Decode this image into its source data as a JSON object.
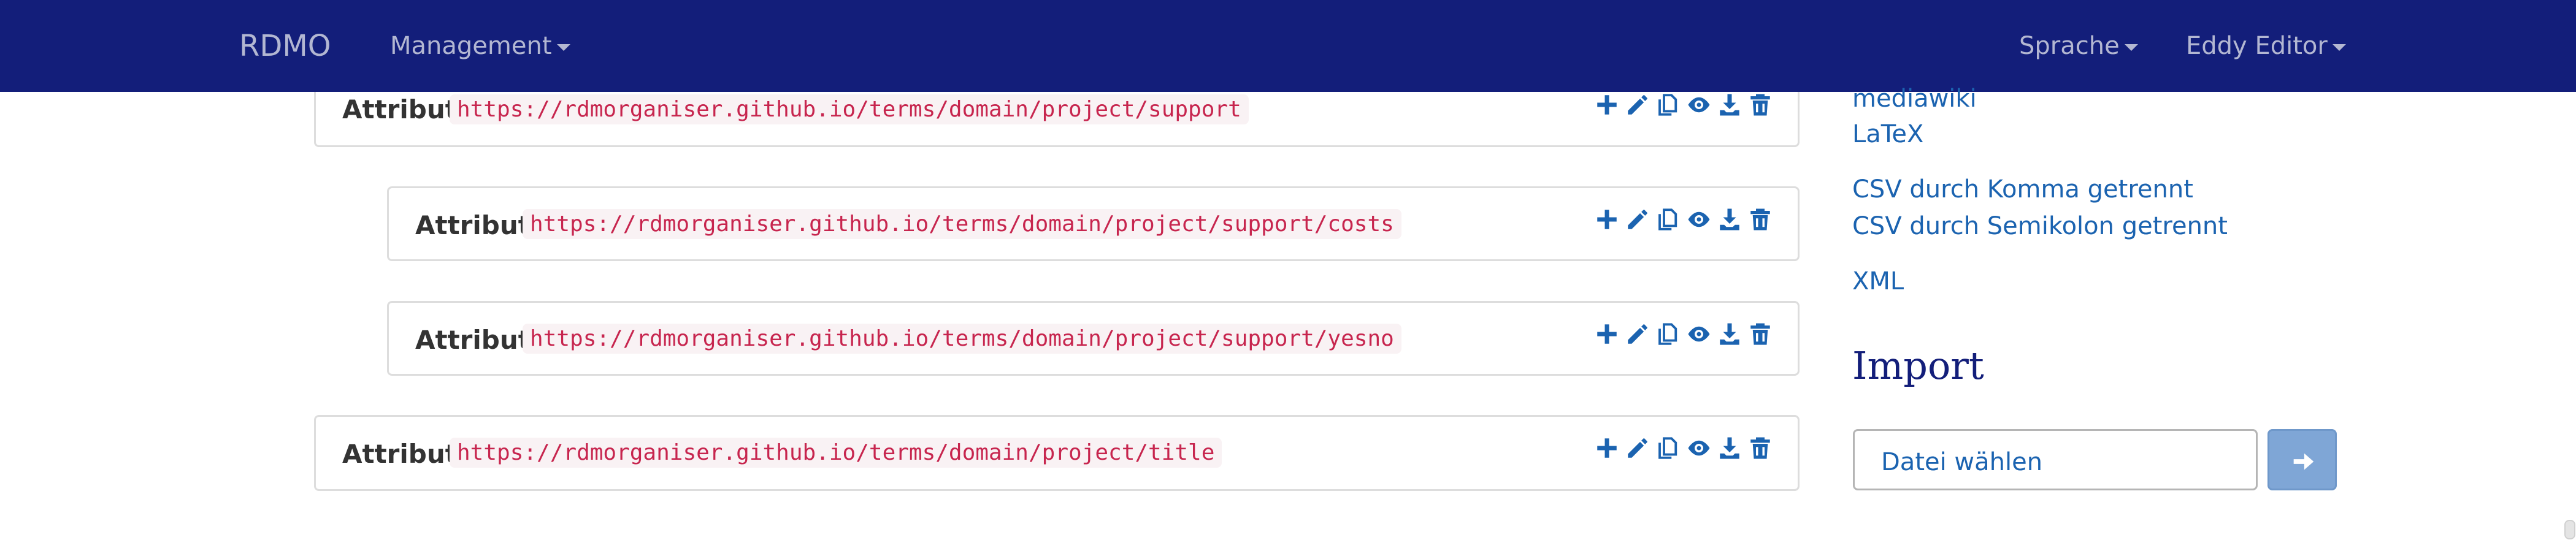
{
  "navbar": {
    "brand": "RDMO",
    "management_label": "Management",
    "language_label": "Sprache",
    "user_label": "Eddy Editor"
  },
  "elements": [
    {
      "label": "Attribut",
      "uri": "https://rdmorganiser.github.io/terms/domain/project/support"
    },
    {
      "label": "Attribut",
      "uri": "https://rdmorganiser.github.io/terms/domain/project/support/costs"
    },
    {
      "label": "Attribut",
      "uri": "https://rdmorganiser.github.io/terms/domain/project/support/yesno"
    },
    {
      "label": "Attribut",
      "uri": "https://rdmorganiser.github.io/terms/domain/project/title"
    }
  ],
  "actions": [
    "plus-icon",
    "pencil-icon",
    "copy-icon",
    "eye-icon",
    "download-icon",
    "trash-icon"
  ],
  "sidebar": {
    "export_links": [
      "mediawiki",
      "LaTeX",
      "CSV durch Komma getrennt",
      "CSV durch Semikolon getrennt",
      "XML"
    ],
    "import_heading": "Import",
    "file_input_placeholder": "Datei wählen",
    "upload_icon": "arrow-right-icon"
  },
  "colors": {
    "navbar": "#131e7a",
    "link": "#1b63b0",
    "code_text": "#c7254e",
    "code_background": "#f9f2f4",
    "button": "#7fa6d6"
  }
}
